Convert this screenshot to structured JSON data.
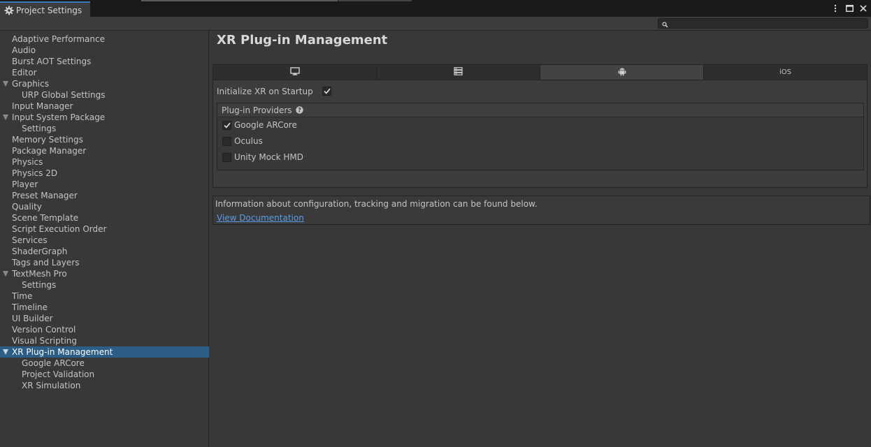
{
  "window": {
    "tab_title": "Project Settings",
    "menu_icon": "kebab-menu-icon",
    "maximize_icon": "maximize-icon",
    "close_icon": "close-icon"
  },
  "search": {
    "placeholder": "",
    "icon": "search-icon"
  },
  "sidebar": {
    "items": [
      {
        "label": "Adaptive Performance",
        "level": 0
      },
      {
        "label": "Audio",
        "level": 0
      },
      {
        "label": "Burst AOT Settings",
        "level": 0
      },
      {
        "label": "Editor",
        "level": 0
      },
      {
        "label": "Graphics",
        "level": 0,
        "expanded": true
      },
      {
        "label": "URP Global Settings",
        "level": 1
      },
      {
        "label": "Input Manager",
        "level": 0
      },
      {
        "label": "Input System Package",
        "level": 0,
        "expanded": true
      },
      {
        "label": "Settings",
        "level": 1
      },
      {
        "label": "Memory Settings",
        "level": 0
      },
      {
        "label": "Package Manager",
        "level": 0
      },
      {
        "label": "Physics",
        "level": 0
      },
      {
        "label": "Physics 2D",
        "level": 0
      },
      {
        "label": "Player",
        "level": 0
      },
      {
        "label": "Preset Manager",
        "level": 0
      },
      {
        "label": "Quality",
        "level": 0
      },
      {
        "label": "Scene Template",
        "level": 0
      },
      {
        "label": "Script Execution Order",
        "level": 0
      },
      {
        "label": "Services",
        "level": 0
      },
      {
        "label": "ShaderGraph",
        "level": 0
      },
      {
        "label": "Tags and Layers",
        "level": 0
      },
      {
        "label": "TextMesh Pro",
        "level": 0,
        "expanded": true
      },
      {
        "label": "Settings",
        "level": 1
      },
      {
        "label": "Time",
        "level": 0
      },
      {
        "label": "Timeline",
        "level": 0
      },
      {
        "label": "UI Builder",
        "level": 0
      },
      {
        "label": "Version Control",
        "level": 0
      },
      {
        "label": "Visual Scripting",
        "level": 0
      },
      {
        "label": "XR Plug-in Management",
        "level": 0,
        "expanded": true,
        "selected": true
      },
      {
        "label": "Google ARCore",
        "level": 1
      },
      {
        "label": "Project Validation",
        "level": 1
      },
      {
        "label": "XR Simulation",
        "level": 1
      }
    ]
  },
  "main": {
    "title": "XR Plug-in Management",
    "platform_tabs": [
      {
        "icon": "desktop-icon",
        "label": "",
        "active": false
      },
      {
        "icon": "server-icon",
        "label": "",
        "active": false
      },
      {
        "icon": "android-icon",
        "label": "",
        "active": true
      },
      {
        "icon": "",
        "label": "iOS",
        "active": false
      }
    ],
    "init_label": "Initialize XR on Startup",
    "init_checked": true,
    "providers_header": "Plug-in Providers",
    "providers": [
      {
        "label": "Google ARCore",
        "checked": true
      },
      {
        "label": "Oculus",
        "checked": false
      },
      {
        "label": "Unity Mock HMD",
        "checked": false
      }
    ],
    "info_text": "Information about configuration, tracking and migration can be found below.",
    "doc_link": "View Documentation"
  },
  "colors": {
    "background": "#383838",
    "selection": "#2c5d87",
    "link": "#5c9eea",
    "active_tab_accent": "#3a79bb"
  }
}
